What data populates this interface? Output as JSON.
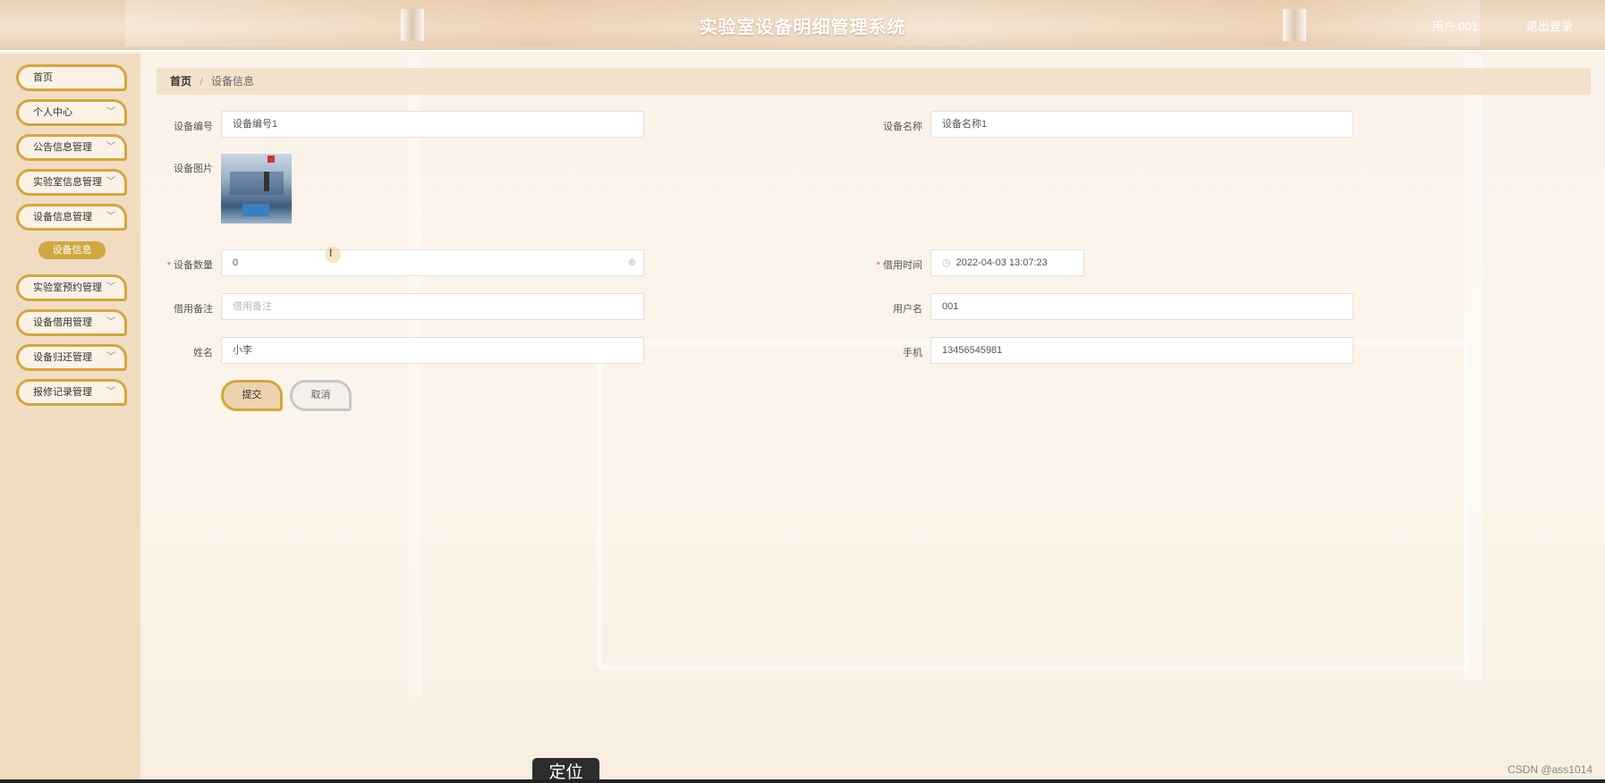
{
  "header": {
    "title": "实验室设备明细管理系统",
    "user": "用户 001",
    "logout": "退出登录"
  },
  "sidebar": {
    "items": [
      {
        "label": "首页",
        "has_chevron": false
      },
      {
        "label": "个人中心",
        "has_chevron": true
      },
      {
        "label": "公告信息管理",
        "has_chevron": true
      },
      {
        "label": "实验室信息管理",
        "has_chevron": true
      },
      {
        "label": "设备信息管理",
        "has_chevron": true
      },
      {
        "label": "实验室预约管理",
        "has_chevron": true
      },
      {
        "label": "设备借用管理",
        "has_chevron": true
      },
      {
        "label": "设备归还管理",
        "has_chevron": true
      },
      {
        "label": "报修记录管理",
        "has_chevron": true
      }
    ],
    "active_sub": "设备信息"
  },
  "breadcrumb": {
    "home": "首页",
    "separator": "/",
    "current": "设备信息"
  },
  "form": {
    "device_no": {
      "label": "设备编号",
      "value": "设备编号1"
    },
    "device_name": {
      "label": "设备名称",
      "value": "设备名称1"
    },
    "device_image": {
      "label": "设备图片"
    },
    "device_qty": {
      "label": "设备数量",
      "value": "0",
      "required": true
    },
    "borrow_time": {
      "label": "借用时间",
      "value": "2022-04-03 13:07:23",
      "required": true
    },
    "borrow_note": {
      "label": "借用备注",
      "placeholder": "借用备注"
    },
    "username": {
      "label": "用户名",
      "value": "001"
    },
    "name": {
      "label": "姓名",
      "value": "小李"
    },
    "phone": {
      "label": "手机",
      "value": "13456545981"
    },
    "submit_label": "提交",
    "cancel_label": "取消"
  },
  "footer": {
    "tab_label": "定位",
    "watermark": "CSDN @ass1014"
  },
  "colors": {
    "accent": "#d1a743",
    "sidebar_bg": "#f1dcc2",
    "breadcrumb_bg": "#f3e2cc"
  }
}
